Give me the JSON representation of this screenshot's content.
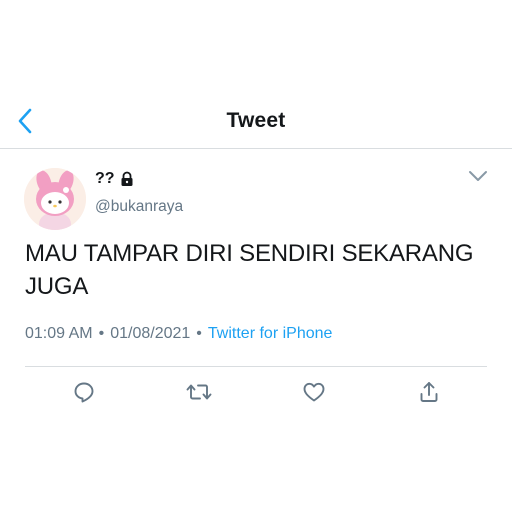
{
  "header": {
    "title": "Tweet"
  },
  "tweet": {
    "author_name": "??",
    "author_handle": "@bukanraya",
    "text": "MAU TAMPAR DIRI SENDIRI SEKARANG JUGA",
    "time": "01:09 AM",
    "separator": "•",
    "date": "01/08/2021",
    "source": "Twitter for iPhone"
  },
  "icons": {
    "back": "chevron-left-icon",
    "lock": "lock-icon",
    "caret": "chevron-down-icon",
    "reply": "reply-icon",
    "retweet": "retweet-icon",
    "like": "heart-icon",
    "share": "share-icon"
  },
  "colors": {
    "accent": "#1da1f2",
    "text_primary": "#14171a",
    "text_secondary": "#657786",
    "divider": "#d9dde0"
  }
}
